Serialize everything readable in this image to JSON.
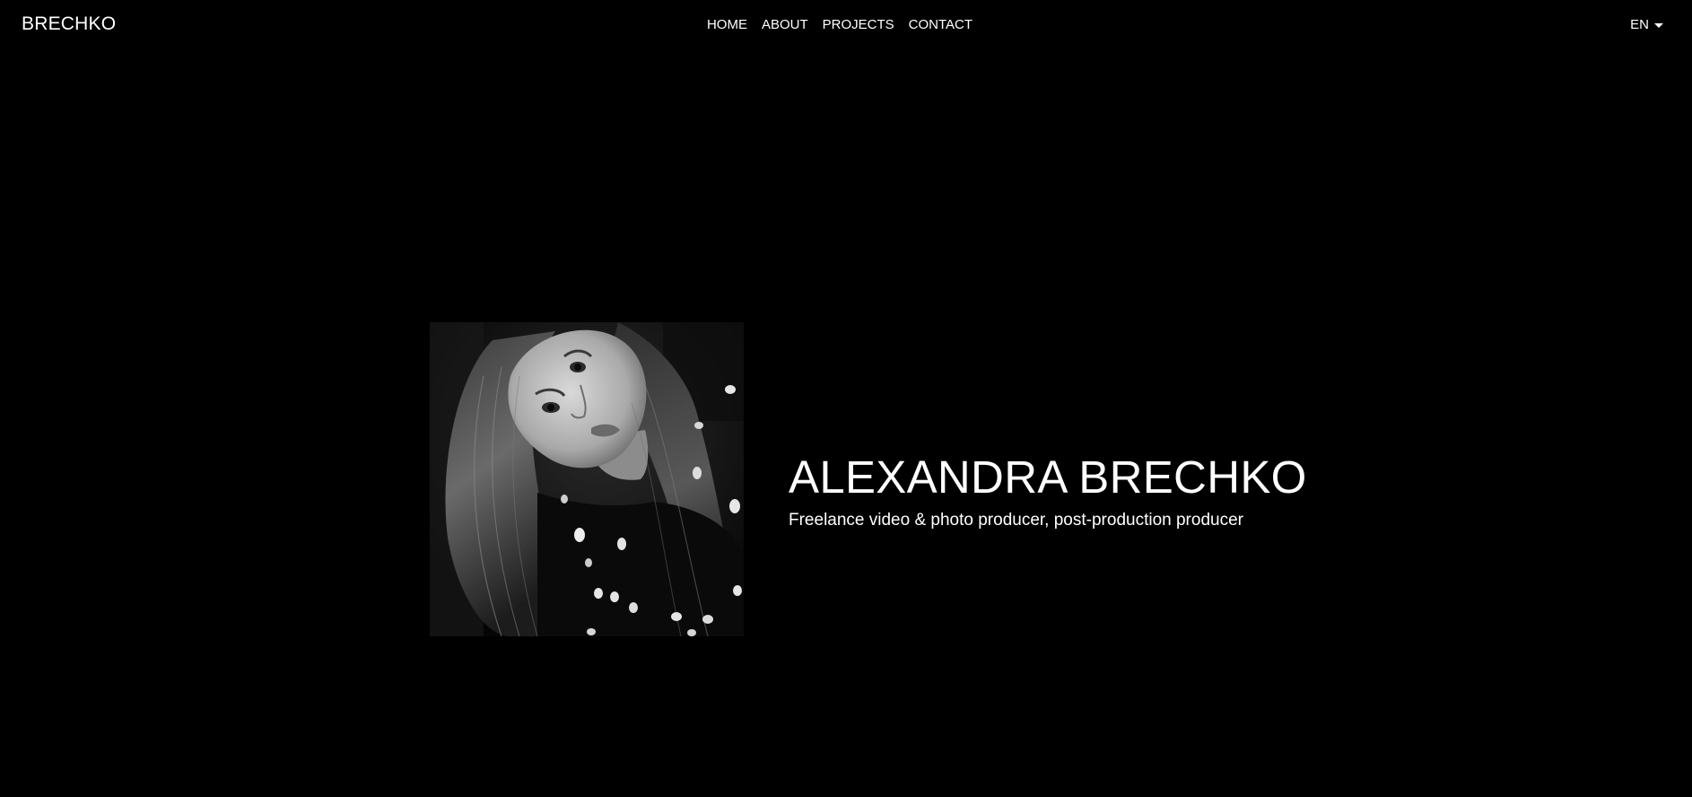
{
  "header": {
    "brand": "BRECHKO",
    "nav": [
      {
        "label": "HOME"
      },
      {
        "label": "ABOUT"
      },
      {
        "label": "PROJECTS"
      },
      {
        "label": "CONTACT"
      }
    ],
    "language": "EN"
  },
  "hero": {
    "name": "ALEXANDRA BRECHKO",
    "subtitle": "Freelance video & photo producer, post-production producer",
    "portrait_alt": "Black and white portrait photo"
  },
  "colors": {
    "background": "#000000",
    "text": "#ffffff"
  }
}
